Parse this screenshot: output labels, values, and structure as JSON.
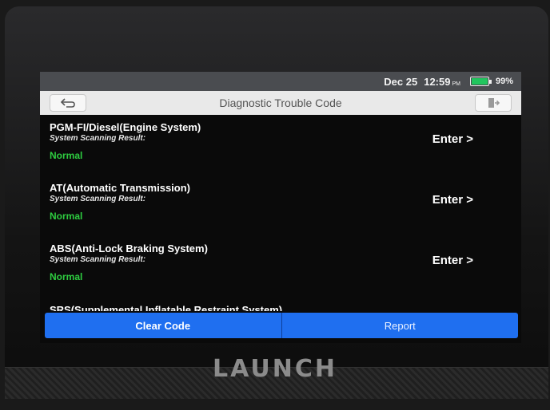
{
  "device": {
    "brand": "LAUNCH"
  },
  "status_bar": {
    "date": "Dec 25",
    "time": "12:59",
    "ampm": "PM",
    "battery": "99%",
    "battery_level": 0.99
  },
  "header": {
    "title": "Diagnostic Trouble Code",
    "back_icon": "back-arrow-icon",
    "exit_icon": "exit-icon"
  },
  "systems": [
    {
      "name": "PGM-FI/Diesel(Engine System)",
      "result_label": "System Scanning Result:",
      "status": "Normal",
      "action": "Enter >"
    },
    {
      "name": "AT(Automatic Transmission)",
      "result_label": "System Scanning Result:",
      "status": "Normal",
      "action": "Enter >"
    },
    {
      "name": "ABS(Anti-Lock Braking System)",
      "result_label": "System Scanning Result:",
      "status": "Normal",
      "action": "Enter >"
    },
    {
      "name": "SRS(Supplemental Inflatable Restraint System)"
    }
  ],
  "footer": {
    "clear_code": "Clear Code",
    "report": "Report"
  },
  "colors": {
    "status_normal": "#2ecc40",
    "button_blue": "#1f6ff0",
    "status_bar_bg": "#4a4c50",
    "title_bar_bg": "#e9e9e9"
  }
}
